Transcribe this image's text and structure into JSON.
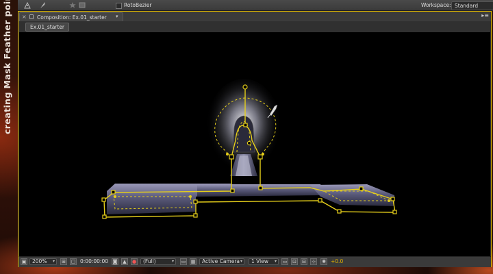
{
  "side_caption": "creating Mask Feather points",
  "toolbar": {
    "rotobezier_label": "RotoBezier",
    "workspace_label": "Workspace:",
    "workspace_value": "Standard"
  },
  "panel": {
    "tab_title": "Composition: Ex.01_starter",
    "breadcrumb": "Ex.01_starter"
  },
  "viewer_controls": {
    "zoom": "200%",
    "timecode": "0:00:00:00",
    "resolution": "(Full)",
    "camera": "Active Camera",
    "views": "1 View",
    "exposure": "+0.0"
  },
  "colors": {
    "mask_path": "#e6cf1a",
    "panel_highlight": "#d9b300",
    "exposure_text": "#e2b300"
  },
  "icons": [
    "pen-tool-icon",
    "feather-tool-icon",
    "star-icon",
    "panel-close-icon",
    "lock-icon",
    "snapshot-icon",
    "color-channel-icon",
    "grid-icon",
    "fast-preview-icon"
  ]
}
